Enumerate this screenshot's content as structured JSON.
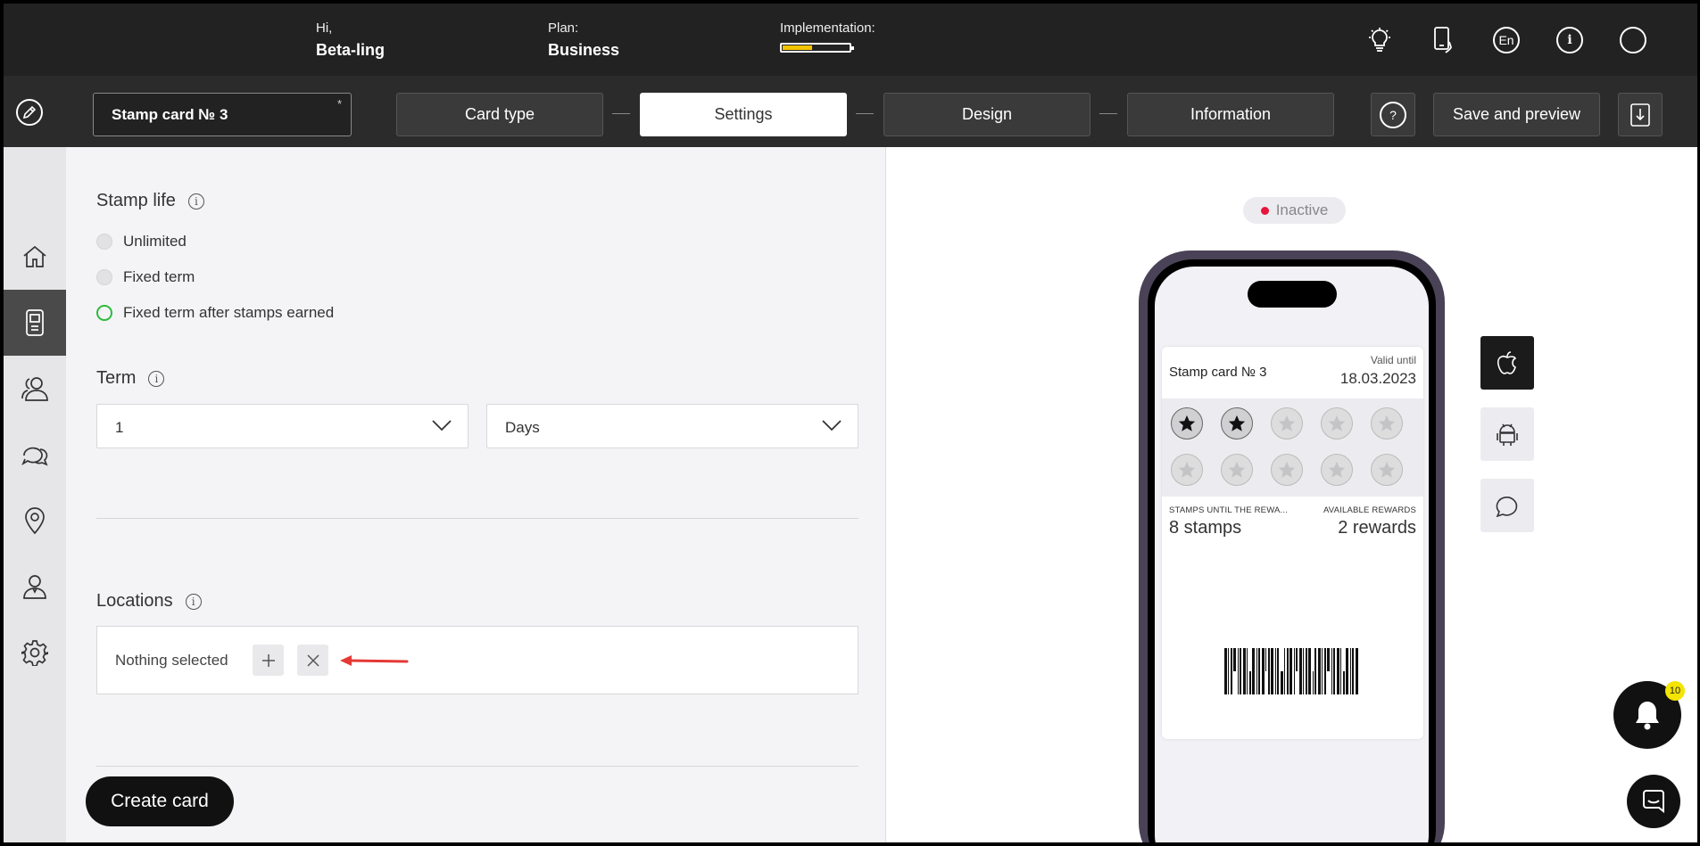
{
  "header": {
    "greeting_label": "Hi,",
    "user_name": "Beta-ling",
    "plan_label": "Plan:",
    "plan_value": "Business",
    "implementation_label": "Implementation:",
    "implementation_progress": 0.45,
    "icons": [
      "bulb-icon",
      "phone-hand-icon",
      "language-icon",
      "info-icon",
      "profile-circle-icon"
    ],
    "language": "En",
    "info_glyph": "i"
  },
  "toolbar": {
    "card_name": "Stamp card № 3",
    "required_mark": "*",
    "steps": [
      {
        "label": "Card type"
      },
      {
        "label": "Settings"
      },
      {
        "label": "Design"
      },
      {
        "label": "Information"
      }
    ],
    "active_step": "Settings",
    "help_glyph": "?",
    "save_preview_label": "Save and preview"
  },
  "sidebar": {
    "items": [
      "home-icon",
      "card-icon",
      "clients-icon",
      "messages-icon",
      "location-icon",
      "manager-icon",
      "settings-icon"
    ],
    "active_item": "card-icon"
  },
  "form": {
    "stamp_life": {
      "title": "Stamp life",
      "options": [
        "Unlimited",
        "Fixed term",
        "Fixed term after stamps earned"
      ],
      "selected": "Fixed term after stamps earned"
    },
    "term": {
      "title": "Term",
      "value": "1",
      "unit": "Days"
    },
    "locations": {
      "title": "Locations",
      "value": "Nothing selected"
    },
    "create_button": "Create card"
  },
  "preview": {
    "status": "Inactive",
    "status_color": "#e8163a",
    "card": {
      "title": "Stamp card № 3",
      "valid_until_label": "Valid until",
      "valid_until": "18.03.2023",
      "stamps_total": 10,
      "stamps_filled": 2,
      "stamps_until_label": "STAMPS UNTIL THE REWA...",
      "stamps_until_value": "8 stamps",
      "rewards_label": "AVAILABLE REWARDS",
      "rewards_value": "2 rewards"
    },
    "platform_buttons": [
      "apple-icon",
      "android-icon",
      "chat-bubble-icon"
    ],
    "active_platform": "apple-icon",
    "notification_count": "10"
  },
  "colors": {
    "topbar_bg": "#222222",
    "accent_progress": "#f5c400",
    "radio_selected": "#2dbb3c",
    "annotation_arrow": "#e53935"
  }
}
